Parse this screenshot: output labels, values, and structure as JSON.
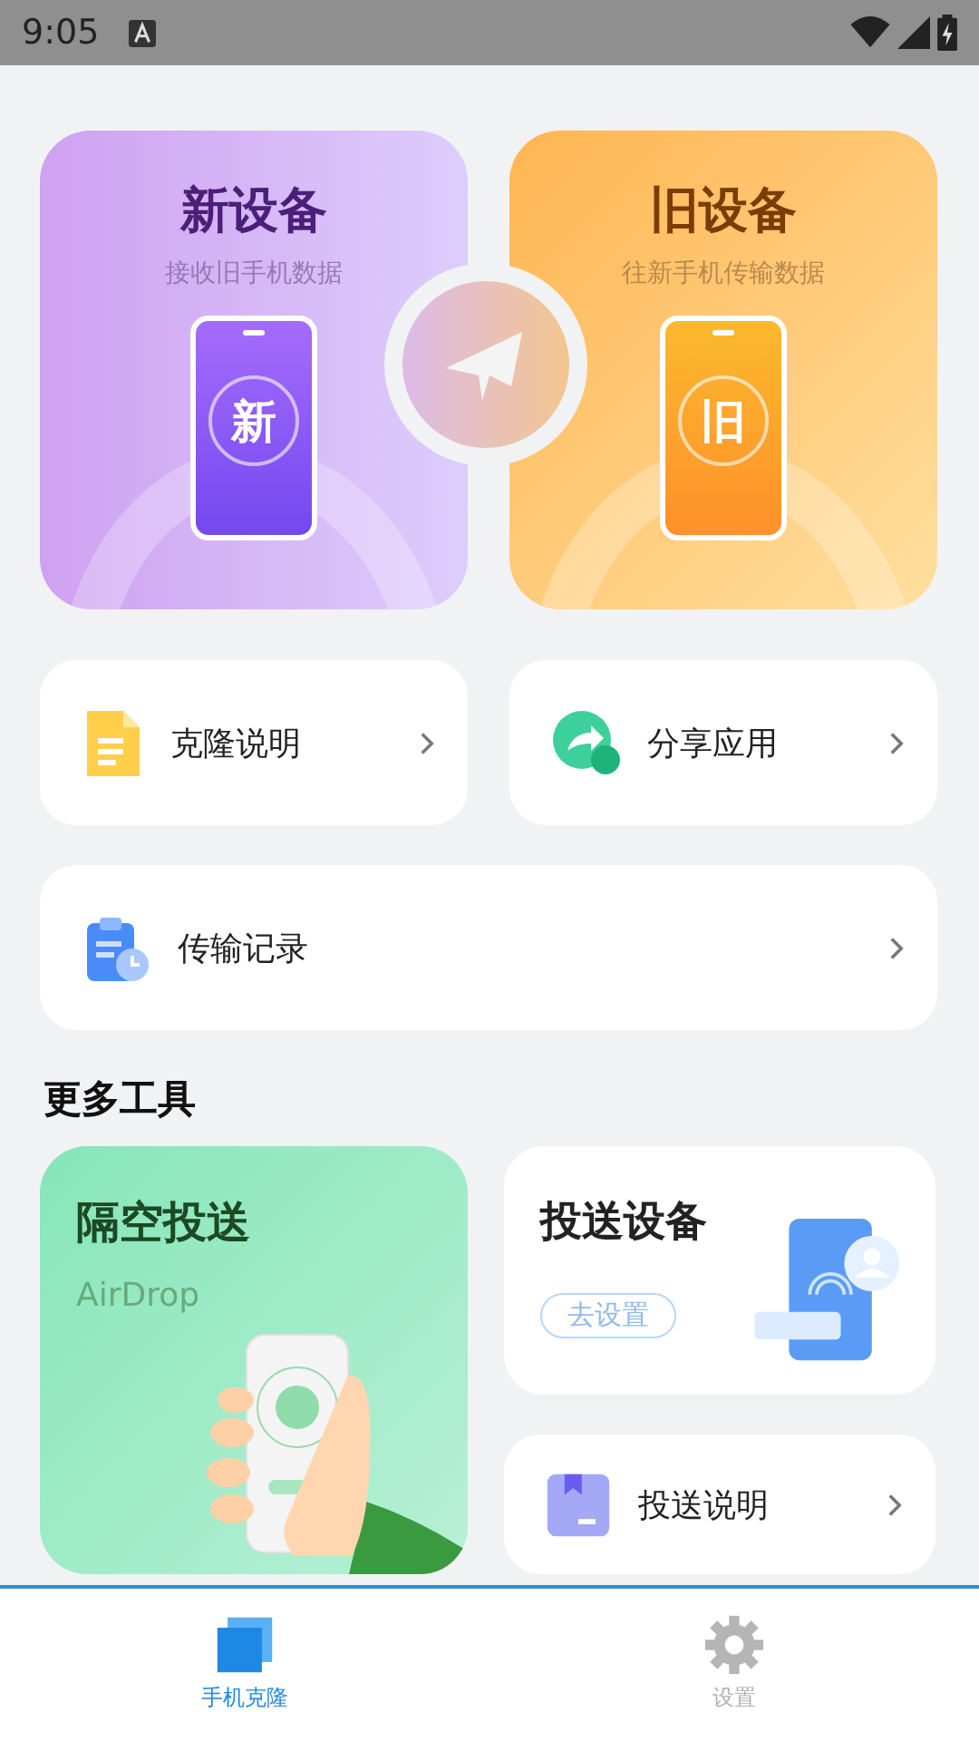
{
  "status_bar": {
    "time": "9:05"
  },
  "device_cards": [
    {
      "kind": "new",
      "title": "新设备",
      "subtitle": "接收旧手机数据",
      "phone_label": "新"
    },
    {
      "kind": "old",
      "title": "旧设备",
      "subtitle": "往新手机传输数据",
      "phone_label": "旧"
    }
  ],
  "quick_links": [
    {
      "kind": "document",
      "label": "克隆说明"
    },
    {
      "kind": "share",
      "label": "分享应用"
    },
    {
      "kind": "clipboard",
      "label": "传输记录"
    }
  ],
  "more_tools": {
    "title": "更多工具",
    "airdrop": {
      "title": "隔空投送",
      "subtitle": "AirDrop"
    },
    "cast": {
      "title": "投送设备",
      "button": "去设置"
    },
    "cast_help": {
      "kind": "box",
      "label": "投送说明"
    }
  },
  "bottom_nav": [
    {
      "kind": "clone",
      "label": "手机克隆",
      "selected": true
    },
    {
      "kind": "gear",
      "label": "设置",
      "selected": false
    }
  ]
}
